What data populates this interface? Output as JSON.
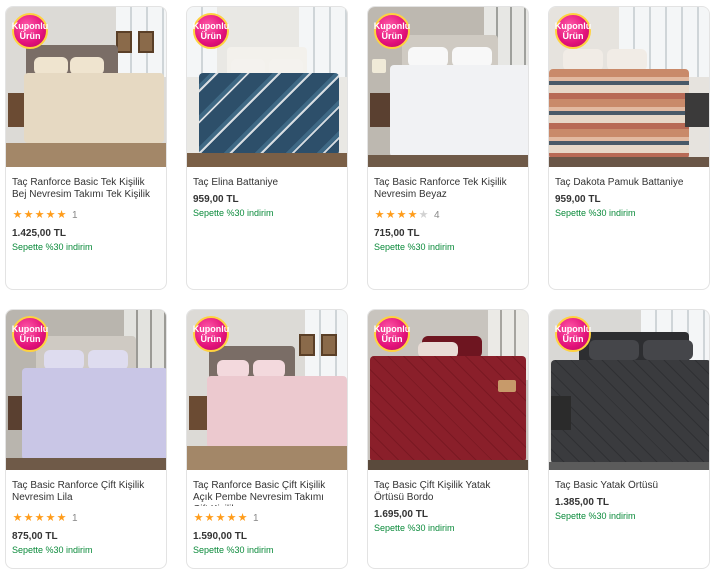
{
  "badge": {
    "line1": "Kuponlu",
    "line2": "Ürün"
  },
  "products": [
    {
      "title": "Taç Ranforce Basic Tek Kişilik Bej Nevresim Takımı Tek Kişilik",
      "rating": 5,
      "rating_count": "1",
      "price": "1.425,00 TL",
      "promo": "Sepette %30 indirim",
      "image": "beige-duvet-set-bedroom",
      "color": "#e6d9c2"
    },
    {
      "title": "Taç Elina Battaniye",
      "price": "959,00 TL",
      "promo": "Sepette %30 indirim",
      "image": "navy-patterned-blanket-bedroom",
      "color": "#2d4f6a"
    },
    {
      "title": "Taç Basic Ranforce Tek Kişilik Nevresim Beyaz",
      "rating": 4,
      "rating_count": "4",
      "price": "715,00 TL",
      "promo": "Sepette %30 indirim",
      "image": "white-duvet-set-bedroom",
      "color": "#f1f2f4"
    },
    {
      "title": "Taç Dakota Pamuk Battaniye",
      "price": "959,00 TL",
      "promo": "Sepette %30 indirim",
      "image": "striped-cotton-blanket-bedroom",
      "color": "#c98a6a"
    },
    {
      "title": "Taç Basic Ranforce Çift Kişilik Nevresim Lila",
      "rating": 5,
      "rating_count": "1",
      "price": "875,00 TL",
      "promo": "Sepette %30 indirim",
      "image": "lilac-duvet-set-bedroom",
      "color": "#c9c6e6"
    },
    {
      "title": "Taç Ranforce Basic Çift Kişilik Açık Pembe Nevresim Takımı Çift Kişilik",
      "rating": 5,
      "rating_count": "1",
      "price": "1.590,00 TL",
      "promo": "Sepette %30 indirim",
      "image": "light-pink-duvet-set-bedroom",
      "color": "#ecc9cf"
    },
    {
      "title": "Taç Basic Çift Kişilik Yatak Örtüsü Bordo",
      "price": "1.695,00 TL",
      "promo": "Sepette %30 indirim",
      "image": "burgundy-bedspread-bedroom",
      "color": "#8a1f2a"
    },
    {
      "title": "Taç Basic Yatak Örtüsü",
      "price": "1.385,00 TL",
      "promo": "Sepette %30 indirim",
      "image": "dark-grey-bedspread-bedroom",
      "color": "#3a3b3e"
    }
  ]
}
